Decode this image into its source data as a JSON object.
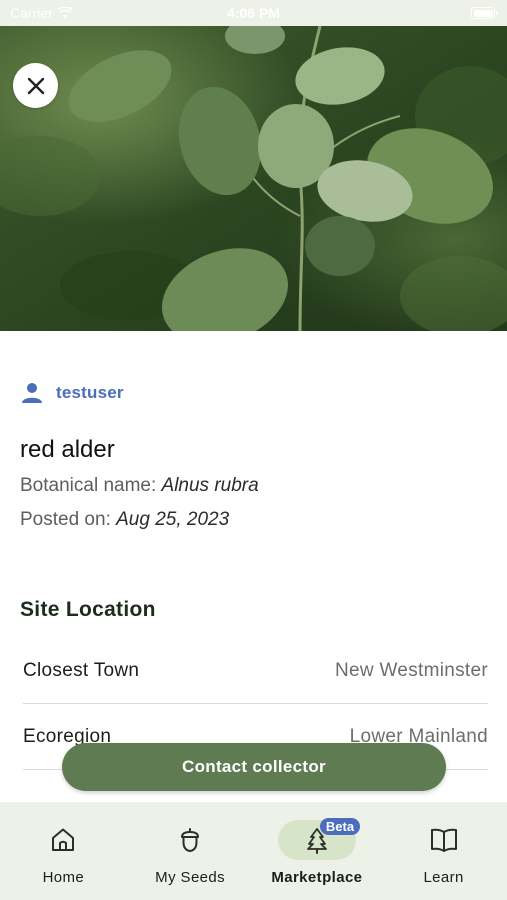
{
  "status_bar": {
    "carrier": "Carrier",
    "time": "4:06 PM"
  },
  "listing": {
    "username": "testuser",
    "common_name": "red alder",
    "botanical_label": "Botanical name:",
    "botanical_name": "Alnus rubra",
    "posted_label": "Posted on:",
    "posted_date": "Aug 25, 2023"
  },
  "site_location": {
    "heading": "Site Location",
    "rows": [
      {
        "label": "Closest Town",
        "value": "New Westminster"
      },
      {
        "label": "Ecoregion",
        "value": "Lower Mainland"
      }
    ]
  },
  "contact_button": "Contact collector",
  "nav": {
    "items": [
      {
        "label": "Home",
        "icon": "home-icon"
      },
      {
        "label": "My Seeds",
        "icon": "acorn-icon"
      },
      {
        "label": "Marketplace",
        "icon": "tree-icon",
        "badge": "Beta",
        "active": true
      },
      {
        "label": "Learn",
        "icon": "book-icon"
      }
    ]
  },
  "colors": {
    "accent": "#5e7b52",
    "link": "#4a6dbd",
    "nav_bg": "#eef1e7",
    "active_pill": "#d6e5c8"
  }
}
